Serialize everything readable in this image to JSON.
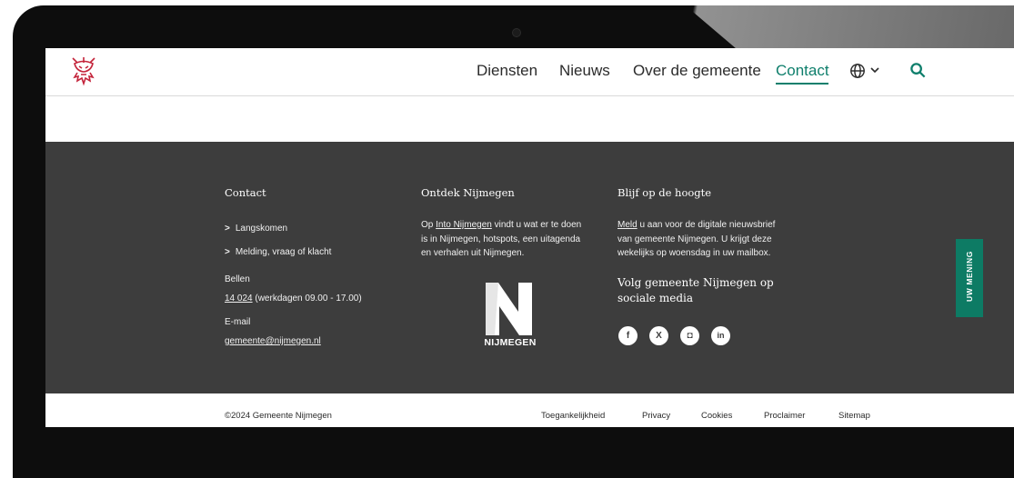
{
  "nav": {
    "items": [
      {
        "label": "Diensten"
      },
      {
        "label": "Nieuws"
      },
      {
        "label": "Over de gemeente"
      },
      {
        "label": "Contact"
      }
    ]
  },
  "footer": {
    "contact": {
      "title": "Contact",
      "links": [
        "Langskomen",
        "Melding, vraag of klacht"
      ],
      "phone_label": "Bellen",
      "phone_number": "14 024",
      "phone_hours": " (werkdagen 09.00 - 17.00)",
      "email_label": "E-mail",
      "email": "gemeente@nijmegen.nl"
    },
    "discover": {
      "title": "Ontdek Nijmegen",
      "text_pre": "Op ",
      "link": "Into Nijmegen",
      "text_line1_rest": " vindt u wat er te doen",
      "text_line2": "is in Nijmegen, hotspots, een uitagenda",
      "text_line3": "en verhalen uit Nijmegen.",
      "logo_text": "NIJMEGEN"
    },
    "news": {
      "title": "Blijf op de hoogte",
      "link": "Meld",
      "text_line1_rest": " u aan voor de digitale nieuwsbrief",
      "text_line2": "van gemeente Nijmegen. U krijgt deze",
      "text_line3": "wekelijks op woensdag in uw mailbox.",
      "social_title_line1": "Volg gemeente Nijmegen op",
      "social_title_line2": "sociale media",
      "social": [
        {
          "icon": "facebook-icon",
          "glyph": "f"
        },
        {
          "icon": "x-icon",
          "glyph": "X"
        },
        {
          "icon": "instagram-icon",
          "glyph": "◘"
        },
        {
          "icon": "linkedin-icon",
          "glyph": "in"
        }
      ]
    },
    "feedback_tab": "UW MENING"
  },
  "bottom": {
    "copyright": "©2024  Gemeente Nijmegen",
    "links": [
      "Toegankelijkheid",
      "Privacy",
      "Cookies",
      "Proclaimer",
      "Sitemap"
    ]
  },
  "colors": {
    "accent": "#0f7f6c",
    "footer_bg": "#3d3d3d",
    "logo_red": "#c4243b"
  }
}
